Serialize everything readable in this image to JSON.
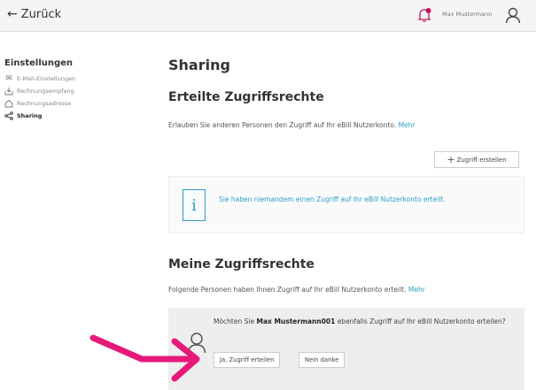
{
  "topbar": {
    "back_label": "Zurück",
    "user_name": "Max Mustermann"
  },
  "sidebar": {
    "title": "Einstellungen",
    "items": [
      {
        "label": "E-Mail-Einstellungen",
        "icon": "mail-icon",
        "active": false
      },
      {
        "label": "Rechnungsempfang",
        "icon": "inbox-icon",
        "active": false
      },
      {
        "label": "Rechnungsadresse",
        "icon": "home-icon",
        "active": false
      },
      {
        "label": "Sharing",
        "icon": "share-icon",
        "active": true
      }
    ]
  },
  "main": {
    "title": "Sharing",
    "granted": {
      "title": "Erteilte Zugriffsrechte",
      "desc": "Erlauben Sie anderen Personen den Zugriff auf Ihr eBill Nutzerkonto.",
      "more_link": "Mehr",
      "create_button": "Zugriff erstellen",
      "info_text": "Sie haben niemandem einen Zugriff auf Ihr eBill Nutzerkonto erteilt."
    },
    "mine": {
      "title": "Meine Zugriffsrechte",
      "desc": "Folgende Personen haben Ihnen Zugriff auf Ihr eBill Nutzerkonto erteilt.",
      "more_link": "Mehr",
      "request_prefix": "Möchten Sie ",
      "request_user": "Max Mustermann001",
      "request_suffix": " ebenfalls Zugriff auf Ihr eBill Nutzerkonto erteilen?",
      "yes_button": "Ja, Zugriff erteilen",
      "no_button": "Nein danke"
    }
  },
  "colors": {
    "accent": "#2a9fc9",
    "annotation_arrow": "#e6197a",
    "notification": "#c2185b"
  }
}
